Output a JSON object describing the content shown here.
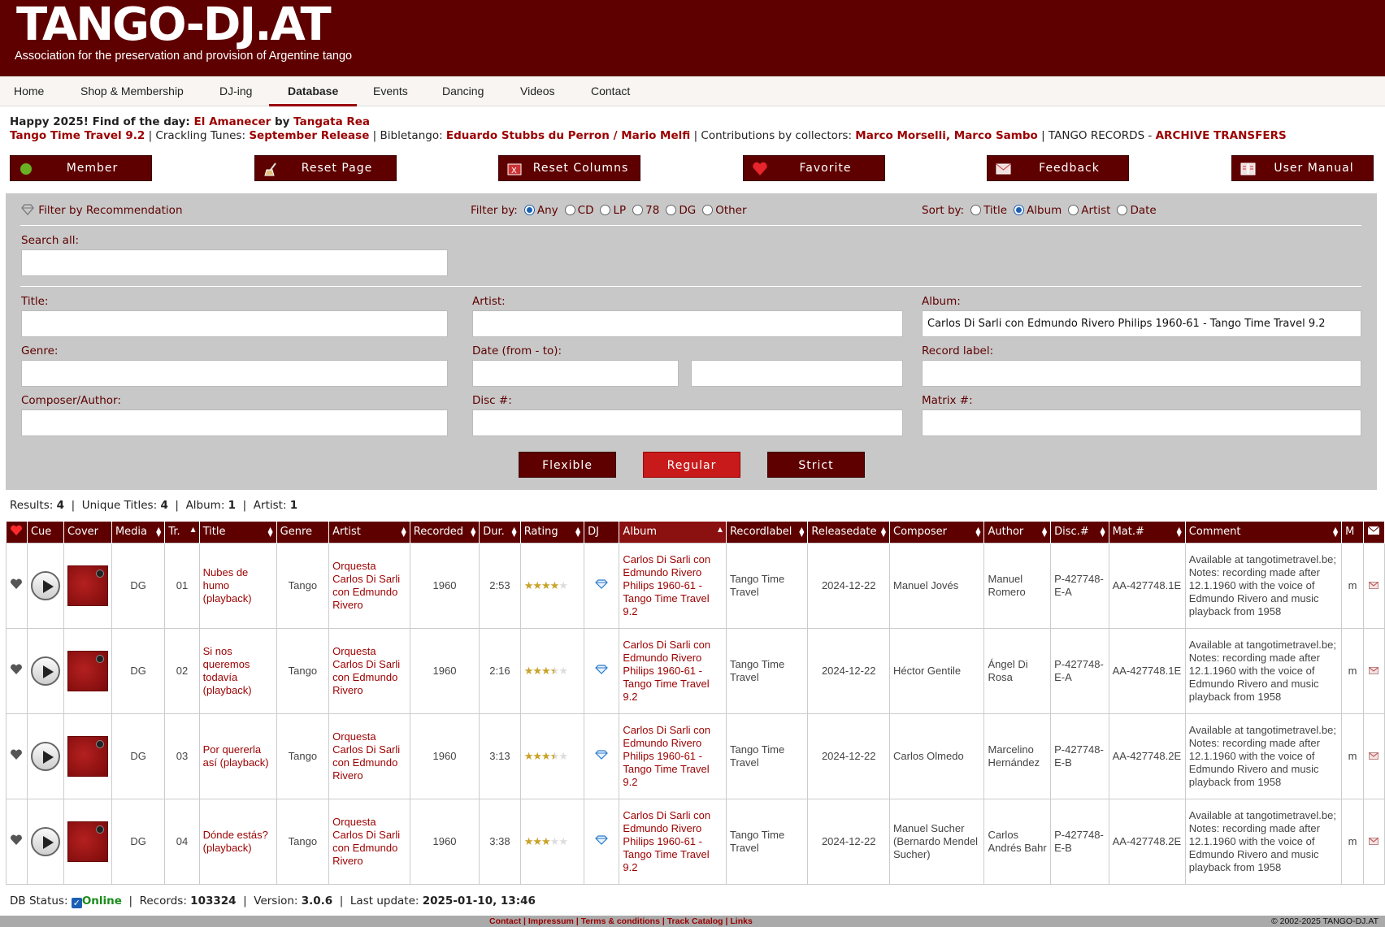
{
  "header": {
    "logo": "TANGO-DJ.AT",
    "tagline": "Association for the preservation and provision of Argentine tango"
  },
  "nav": [
    {
      "label": "Home"
    },
    {
      "label": "Shop & Membership"
    },
    {
      "label": "DJ-ing"
    },
    {
      "label": "Database"
    },
    {
      "label": "Events"
    },
    {
      "label": "Dancing"
    },
    {
      "label": "Videos"
    },
    {
      "label": "Contact"
    }
  ],
  "news": {
    "l1_a": "Happy 2025! Find of the day: ",
    "l1_title": "El Amanecer",
    "l1_by": " by ",
    "l1_artist": "Tangata Rea",
    "l2_ttt": "Tango Time Travel 9.2",
    "l2_sep1": " | Crackling Tunes: ",
    "l2_sept": "September Release",
    "l2_sep2": " | Bibletango: ",
    "l2_esdp": "Eduardo Stubbs du Perron",
    "l2_slash": " / ",
    "l2_mm": "Mario Melfi",
    "l2_sep3": " | Contributions by collectors: ",
    "l2_mmo": "Marco Morselli",
    "l2_comma": ", ",
    "l2_ms": "Marco Sambo",
    "l2_sep4": " | TANGO RECORDS - ",
    "l2_at": "ARCHIVE TRANSFERS"
  },
  "toolbar": {
    "member": "Member",
    "reset_page": "Reset Page",
    "reset_columns": "Reset Columns",
    "favorite": "Favorite",
    "feedback": "Feedback",
    "user_manual": "User Manual"
  },
  "filters": {
    "recommend": "Filter by Recommendation",
    "filter_by": "Filter by:",
    "media_options": [
      "Any",
      "CD",
      "LP",
      "78",
      "DG",
      "Other"
    ],
    "media_selected": "Any",
    "sort_by": "Sort by:",
    "sort_options": [
      "Title",
      "Album",
      "Artist",
      "Date"
    ],
    "sort_selected": "Album",
    "search_all": "Search all:",
    "title": "Title:",
    "artist": "Artist:",
    "album": "Album:",
    "album_value": "Carlos Di Sarli con Edmundo Rivero Philips 1960-61 - Tango Time Travel 9.2",
    "genre": "Genre:",
    "date": "Date (from - to):",
    "record_label": "Record label:",
    "composer": "Composer/Author:",
    "disc": "Disc #:",
    "matrix": "Matrix #:",
    "flexible": "Flexible",
    "regular": "Regular",
    "strict": "Strict"
  },
  "stats": {
    "results_label": "Results: ",
    "results": "4",
    "unique_label": "Unique Titles: ",
    "unique": "4",
    "album_label": "Album: ",
    "album": "1",
    "artist_label": "Artist: ",
    "artist": "1"
  },
  "table": {
    "headers": [
      "Cue",
      "Cover",
      "Media",
      "Tr.",
      "Title",
      "Genre",
      "Artist",
      "Recorded",
      "Dur.",
      "Rating",
      "DJ",
      "Album",
      "Recordlabel",
      "Releasedate",
      "Composer",
      "Author",
      "Disc.#",
      "Mat.#",
      "Comment",
      "M"
    ],
    "rows": [
      {
        "media": "DG",
        "tr": "01",
        "title": "Nubes de humo (playback)",
        "genre": "Tango",
        "artist": "Orquesta Carlos Di Sarli con Edmundo Rivero",
        "recorded": "1960",
        "dur": "2:53",
        "rating": 4,
        "album": "Carlos Di Sarli con Edmundo Rivero Philips 1960-61 - Tango Time Travel 9.2",
        "label": "Tango Time Travel",
        "release": "2024-12-22",
        "composer": "Manuel Jovés",
        "author": "Manuel Romero",
        "disc": "P-427748-E-A",
        "mat": "AA-427748.1E",
        "comment": "Available at tangotimetravel.be; Notes: recording made after 12.1.1960 with the voice of Edmundo Rivero and music playback from 1958",
        "m": "m"
      },
      {
        "media": "DG",
        "tr": "02",
        "title": "Si nos queremos todavía (playback)",
        "genre": "Tango",
        "artist": "Orquesta Carlos Di Sarli con Edmundo Rivero",
        "recorded": "1960",
        "dur": "2:16",
        "rating": 3.5,
        "album": "Carlos Di Sarli con Edmundo Rivero Philips 1960-61 - Tango Time Travel 9.2",
        "label": "Tango Time Travel",
        "release": "2024-12-22",
        "composer": "Héctor Gentile",
        "author": "Ángel Di Rosa",
        "disc": "P-427748-E-A",
        "mat": "AA-427748.1E",
        "comment": "Available at tangotimetravel.be; Notes: recording made after 12.1.1960 with the voice of Edmundo Rivero and music playback from 1958",
        "m": "m"
      },
      {
        "media": "DG",
        "tr": "03",
        "title": "Por quererla así (playback)",
        "genre": "Tango",
        "artist": "Orquesta Carlos Di Sarli con Edmundo Rivero",
        "recorded": "1960",
        "dur": "3:13",
        "rating": 3.5,
        "album": "Carlos Di Sarli con Edmundo Rivero Philips 1960-61 - Tango Time Travel 9.2",
        "label": "Tango Time Travel",
        "release": "2024-12-22",
        "composer": "Carlos Olmedo",
        "author": "Marcelino Hernández",
        "disc": "P-427748-E-B",
        "mat": "AA-427748.2E",
        "comment": "Available at tangotimetravel.be; Notes: recording made after 12.1.1960 with the voice of Edmundo Rivero and music playback from 1958",
        "m": "m"
      },
      {
        "media": "DG",
        "tr": "04",
        "title": "Dónde estás? (playback)",
        "genre": "Tango",
        "artist": "Orquesta Carlos Di Sarli con Edmundo Rivero",
        "recorded": "1960",
        "dur": "3:38",
        "rating": 3,
        "album": "Carlos Di Sarli con Edmundo Rivero Philips 1960-61 - Tango Time Travel 9.2",
        "label": "Tango Time Travel",
        "release": "2024-12-22",
        "composer": "Manuel Sucher (Bernardo Mendel Sucher)",
        "author": "Carlos Andrés Bahr",
        "disc": "P-427748-E-B",
        "mat": "AA-427748.2E",
        "comment": "Available at tangotimetravel.be; Notes: recording made after 12.1.1960 with the voice of Edmundo Rivero and music playback from 1958",
        "m": "m"
      }
    ]
  },
  "status": {
    "db_label": "DB Status: ",
    "online": "Online",
    "records_label": "Records: ",
    "records": "103324",
    "version_label": "Version: ",
    "version": "3.0.6",
    "update_label": "Last update: ",
    "update": "2025-01-10, 13:46"
  },
  "footer": {
    "links": [
      "Contact",
      "Impressum",
      "Terms & conditions",
      "Track Catalog",
      "Links"
    ],
    "copyright": "© 2002-2025 TANGO-DJ.AT"
  },
  "colors": {
    "brand": "#5e0000",
    "accent": "#9b0000",
    "regular": "#c81a1a"
  }
}
